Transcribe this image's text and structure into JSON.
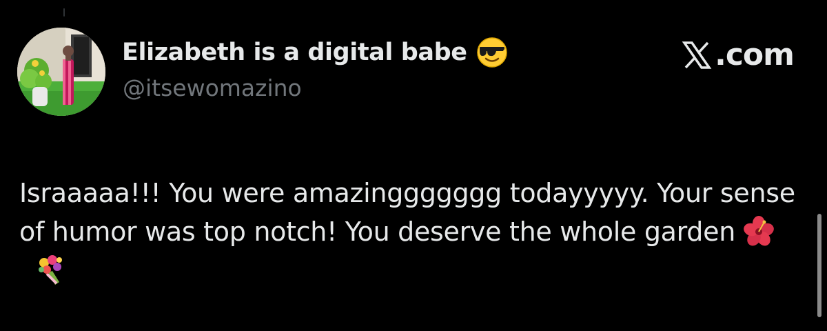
{
  "author": {
    "display_name": "Elizabeth is a digital babe",
    "handle": "@itsewomazino",
    "name_emoji": "smiling-face-with-sunglasses-icon"
  },
  "brand": {
    "text": ".com",
    "logo": "x-logo-icon"
  },
  "tweet": {
    "text": "Israaaaa!!! You were amazinggggggg todayyyyy. Your sense of humor was top notch! You deserve the whole garden",
    "emojis": [
      "hibiscus-icon",
      "bouquet-icon"
    ]
  },
  "colors": {
    "background": "#000000",
    "primary_text": "#e7e9ea",
    "secondary_text": "#71767b"
  }
}
